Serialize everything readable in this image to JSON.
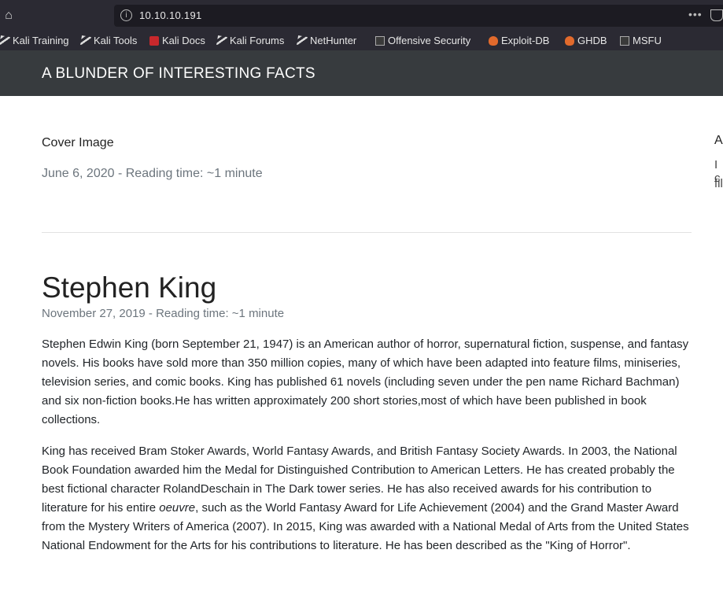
{
  "browser": {
    "url": "10.10.10.191",
    "bookmarks": [
      {
        "label": "Kali Training",
        "icon": "kali-dragon-icon"
      },
      {
        "label": "Kali Tools",
        "icon": "kali-dragon-icon"
      },
      {
        "label": "Kali Docs",
        "icon": "kali-docs-icon"
      },
      {
        "label": "Kali Forums",
        "icon": "kali-dragon-icon"
      },
      {
        "label": "NetHunter",
        "icon": "kali-dragon-icon"
      },
      {
        "label": "Offensive Security",
        "icon": "offsec-icon"
      },
      {
        "label": "Exploit-DB",
        "icon": "exploitdb-icon"
      },
      {
        "label": "GHDB",
        "icon": "exploitdb-icon"
      },
      {
        "label": "MSFU",
        "icon": "offsec-icon"
      }
    ]
  },
  "site": {
    "title": "A BLUNDER OF INTERESTING FACTS"
  },
  "posts": [
    {
      "title": "Cover Image",
      "meta": "June 6, 2020 - Reading time: ~1 minute"
    },
    {
      "title": "Stephen King",
      "meta": "November 27, 2019 - Reading time: ~1 minute",
      "p1": "Stephen Edwin King (born September 21, 1947) is an American author of horror, supernatural fiction, suspense, and fantasy novels. His books have sold more than 350 million copies, many of which have been adapted into feature films, miniseries, television series, and comic books. King has published 61 novels (including seven under the pen name Richard Bachman) and six non-fiction books.He has written approximately 200 short stories,most of which have been published in book collections.",
      "p2_a": "King has received Bram Stoker Awards, World Fantasy Awards, and British Fantasy Society Awards. In 2003, the National Book Foundation awarded him the Medal for Distinguished Contribution to American Letters. He has created probably the best fictional character RolandDeschain in The Dark tower series. He has also received awards for his contribution to literature for his entire ",
      "p2_em": "oeuvre",
      "p2_b": ", such as the World Fantasy Award for Life Achievement (2004) and the Grand Master Award from the Mystery Writers of America (2007). In 2015, King was awarded with a National Medal of Arts from the United States National Endowment for the Arts for his contributions to literature. He has been described as the \"King of Horror\"."
    }
  ],
  "sidebar": {
    "heading_fragment": "A",
    "text_line1": "I c",
    "text_line2": "fil"
  }
}
